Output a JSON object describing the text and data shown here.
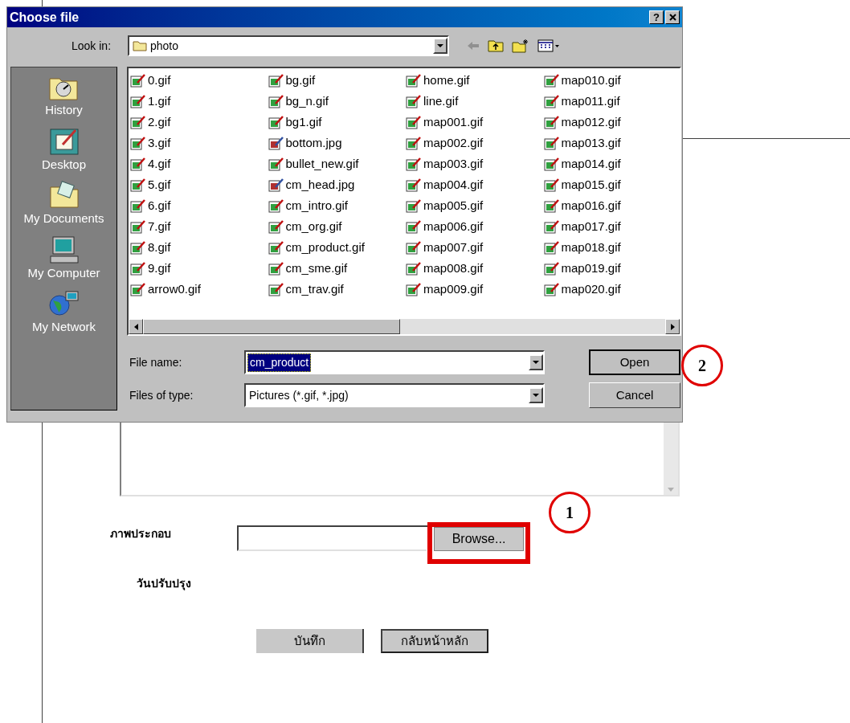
{
  "dialog": {
    "title": "Choose file",
    "help": "?",
    "look_in": {
      "label": "Look in:",
      "value": "photo"
    },
    "places": [
      {
        "label": "History",
        "kind": "history"
      },
      {
        "label": "Desktop",
        "kind": "desktop"
      },
      {
        "label": "My Documents",
        "kind": "documents"
      },
      {
        "label": "My Computer",
        "kind": "computer"
      },
      {
        "label": "My Network",
        "kind": "network"
      }
    ],
    "files": [
      {
        "name": "0.gif",
        "kind": "gif"
      },
      {
        "name": "1.gif",
        "kind": "gif"
      },
      {
        "name": "2.gif",
        "kind": "gif"
      },
      {
        "name": "3.gif",
        "kind": "gif"
      },
      {
        "name": "4.gif",
        "kind": "gif"
      },
      {
        "name": "5.gif",
        "kind": "gif"
      },
      {
        "name": "6.gif",
        "kind": "gif"
      },
      {
        "name": "7.gif",
        "kind": "gif"
      },
      {
        "name": "8.gif",
        "kind": "gif"
      },
      {
        "name": "9.gif",
        "kind": "gif"
      },
      {
        "name": "arrow0.gif",
        "kind": "gif"
      },
      {
        "name": "bg.gif",
        "kind": "gif"
      },
      {
        "name": "bg_n.gif",
        "kind": "gif"
      },
      {
        "name": "bg1.gif",
        "kind": "gif"
      },
      {
        "name": "bottom.jpg",
        "kind": "jpg"
      },
      {
        "name": "bullet_new.gif",
        "kind": "gif"
      },
      {
        "name": "cm_head.jpg",
        "kind": "jpg"
      },
      {
        "name": "cm_intro.gif",
        "kind": "gif"
      },
      {
        "name": "cm_org.gif",
        "kind": "gif"
      },
      {
        "name": "cm_product.gif",
        "kind": "gif"
      },
      {
        "name": "cm_sme.gif",
        "kind": "gif"
      },
      {
        "name": "cm_trav.gif",
        "kind": "gif"
      },
      {
        "name": "home.gif",
        "kind": "gif"
      },
      {
        "name": "line.gif",
        "kind": "gif"
      },
      {
        "name": "map001.gif",
        "kind": "gif"
      },
      {
        "name": "map002.gif",
        "kind": "gif"
      },
      {
        "name": "map003.gif",
        "kind": "gif"
      },
      {
        "name": "map004.gif",
        "kind": "gif"
      },
      {
        "name": "map005.gif",
        "kind": "gif"
      },
      {
        "name": "map006.gif",
        "kind": "gif"
      },
      {
        "name": "map007.gif",
        "kind": "gif"
      },
      {
        "name": "map008.gif",
        "kind": "gif"
      },
      {
        "name": "map009.gif",
        "kind": "gif"
      },
      {
        "name": "map010.gif",
        "kind": "gif"
      },
      {
        "name": "map011.gif",
        "kind": "gif"
      },
      {
        "name": "map012.gif",
        "kind": "gif"
      },
      {
        "name": "map013.gif",
        "kind": "gif"
      },
      {
        "name": "map014.gif",
        "kind": "gif"
      },
      {
        "name": "map015.gif",
        "kind": "gif"
      },
      {
        "name": "map016.gif",
        "kind": "gif"
      },
      {
        "name": "map017.gif",
        "kind": "gif"
      },
      {
        "name": "map018.gif",
        "kind": "gif"
      },
      {
        "name": "map019.gif",
        "kind": "gif"
      },
      {
        "name": "map020.gif",
        "kind": "gif"
      }
    ],
    "file_name": {
      "label": "File name:",
      "value": "cm_product"
    },
    "file_type": {
      "label": "Files of type:",
      "value": "Pictures (*.gif, *.jpg)"
    },
    "buttons": [
      {
        "label": "Open",
        "default": true
      },
      {
        "label": "Cancel",
        "default": false
      }
    ]
  },
  "form": {
    "picture": {
      "label": "ภาพประกอบ",
      "button": "Browse..."
    },
    "updated": {
      "label": "วันปรับปรุง"
    },
    "buttons": [
      {
        "label": "บันทึก",
        "pressed": false
      },
      {
        "label": "กลับหน้าหลัก",
        "pressed": true
      }
    ]
  },
  "annotations": [
    {
      "label": "1"
    },
    {
      "label": "2"
    }
  ]
}
